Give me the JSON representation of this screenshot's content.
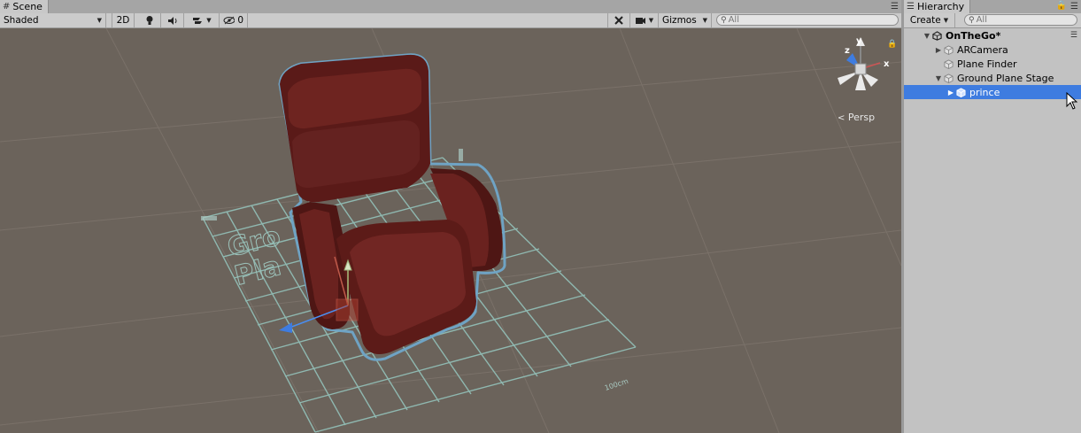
{
  "scene": {
    "tab_label": "Scene",
    "shading_mode": "Shaded",
    "mode_2d": "2D",
    "hidden_count": "0",
    "gizmos_label": "Gizmos",
    "search_placeholder": "All",
    "projection_label": "Persp",
    "gizmo_axes": {
      "x": "x",
      "y": "y",
      "z": "z"
    },
    "ground_label_1": "Gro",
    "ground_label_2": "Pla",
    "scale_label": "100cm"
  },
  "hierarchy": {
    "tab_label": "Hierarchy",
    "create_label": "Create",
    "search_placeholder": "All",
    "root": "OnTheGo*",
    "items": [
      {
        "label": "ARCamera"
      },
      {
        "label": "Plane Finder"
      },
      {
        "label": "Ground Plane Stage"
      },
      {
        "label": "prince"
      }
    ]
  },
  "colors": {
    "viewport_bg": "#6b635b",
    "selection": "#3e7ce0",
    "grid": "#8fb8b0",
    "chair": "#5a1a18"
  }
}
